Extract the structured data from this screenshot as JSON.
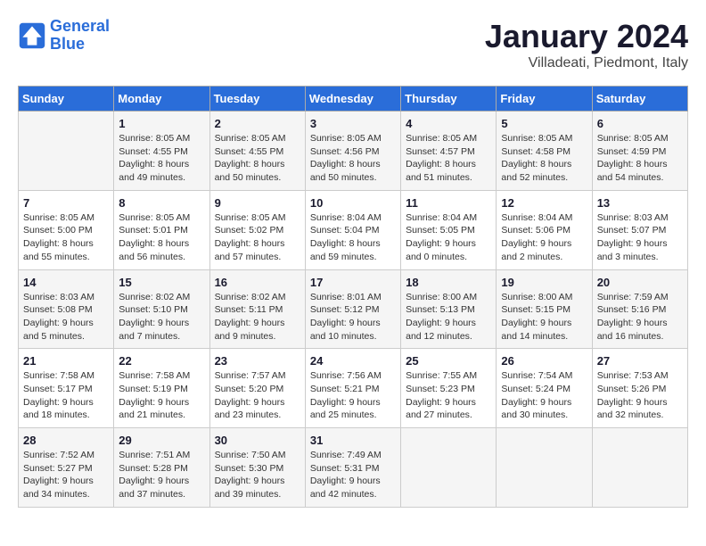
{
  "header": {
    "logo_line1": "General",
    "logo_line2": "Blue",
    "title": "January 2024",
    "subtitle": "Villadeati, Piedmont, Italy"
  },
  "weekdays": [
    "Sunday",
    "Monday",
    "Tuesday",
    "Wednesday",
    "Thursday",
    "Friday",
    "Saturday"
  ],
  "weeks": [
    [
      {
        "day": "",
        "info": ""
      },
      {
        "day": "1",
        "info": "Sunrise: 8:05 AM\nSunset: 4:55 PM\nDaylight: 8 hours\nand 49 minutes."
      },
      {
        "day": "2",
        "info": "Sunrise: 8:05 AM\nSunset: 4:55 PM\nDaylight: 8 hours\nand 50 minutes."
      },
      {
        "day": "3",
        "info": "Sunrise: 8:05 AM\nSunset: 4:56 PM\nDaylight: 8 hours\nand 50 minutes."
      },
      {
        "day": "4",
        "info": "Sunrise: 8:05 AM\nSunset: 4:57 PM\nDaylight: 8 hours\nand 51 minutes."
      },
      {
        "day": "5",
        "info": "Sunrise: 8:05 AM\nSunset: 4:58 PM\nDaylight: 8 hours\nand 52 minutes."
      },
      {
        "day": "6",
        "info": "Sunrise: 8:05 AM\nSunset: 4:59 PM\nDaylight: 8 hours\nand 54 minutes."
      }
    ],
    [
      {
        "day": "7",
        "info": "Sunrise: 8:05 AM\nSunset: 5:00 PM\nDaylight: 8 hours\nand 55 minutes."
      },
      {
        "day": "8",
        "info": "Sunrise: 8:05 AM\nSunset: 5:01 PM\nDaylight: 8 hours\nand 56 minutes."
      },
      {
        "day": "9",
        "info": "Sunrise: 8:05 AM\nSunset: 5:02 PM\nDaylight: 8 hours\nand 57 minutes."
      },
      {
        "day": "10",
        "info": "Sunrise: 8:04 AM\nSunset: 5:04 PM\nDaylight: 8 hours\nand 59 minutes."
      },
      {
        "day": "11",
        "info": "Sunrise: 8:04 AM\nSunset: 5:05 PM\nDaylight: 9 hours\nand 0 minutes."
      },
      {
        "day": "12",
        "info": "Sunrise: 8:04 AM\nSunset: 5:06 PM\nDaylight: 9 hours\nand 2 minutes."
      },
      {
        "day": "13",
        "info": "Sunrise: 8:03 AM\nSunset: 5:07 PM\nDaylight: 9 hours\nand 3 minutes."
      }
    ],
    [
      {
        "day": "14",
        "info": "Sunrise: 8:03 AM\nSunset: 5:08 PM\nDaylight: 9 hours\nand 5 minutes."
      },
      {
        "day": "15",
        "info": "Sunrise: 8:02 AM\nSunset: 5:10 PM\nDaylight: 9 hours\nand 7 minutes."
      },
      {
        "day": "16",
        "info": "Sunrise: 8:02 AM\nSunset: 5:11 PM\nDaylight: 9 hours\nand 9 minutes."
      },
      {
        "day": "17",
        "info": "Sunrise: 8:01 AM\nSunset: 5:12 PM\nDaylight: 9 hours\nand 10 minutes."
      },
      {
        "day": "18",
        "info": "Sunrise: 8:00 AM\nSunset: 5:13 PM\nDaylight: 9 hours\nand 12 minutes."
      },
      {
        "day": "19",
        "info": "Sunrise: 8:00 AM\nSunset: 5:15 PM\nDaylight: 9 hours\nand 14 minutes."
      },
      {
        "day": "20",
        "info": "Sunrise: 7:59 AM\nSunset: 5:16 PM\nDaylight: 9 hours\nand 16 minutes."
      }
    ],
    [
      {
        "day": "21",
        "info": "Sunrise: 7:58 AM\nSunset: 5:17 PM\nDaylight: 9 hours\nand 18 minutes."
      },
      {
        "day": "22",
        "info": "Sunrise: 7:58 AM\nSunset: 5:19 PM\nDaylight: 9 hours\nand 21 minutes."
      },
      {
        "day": "23",
        "info": "Sunrise: 7:57 AM\nSunset: 5:20 PM\nDaylight: 9 hours\nand 23 minutes."
      },
      {
        "day": "24",
        "info": "Sunrise: 7:56 AM\nSunset: 5:21 PM\nDaylight: 9 hours\nand 25 minutes."
      },
      {
        "day": "25",
        "info": "Sunrise: 7:55 AM\nSunset: 5:23 PM\nDaylight: 9 hours\nand 27 minutes."
      },
      {
        "day": "26",
        "info": "Sunrise: 7:54 AM\nSunset: 5:24 PM\nDaylight: 9 hours\nand 30 minutes."
      },
      {
        "day": "27",
        "info": "Sunrise: 7:53 AM\nSunset: 5:26 PM\nDaylight: 9 hours\nand 32 minutes."
      }
    ],
    [
      {
        "day": "28",
        "info": "Sunrise: 7:52 AM\nSunset: 5:27 PM\nDaylight: 9 hours\nand 34 minutes."
      },
      {
        "day": "29",
        "info": "Sunrise: 7:51 AM\nSunset: 5:28 PM\nDaylight: 9 hours\nand 37 minutes."
      },
      {
        "day": "30",
        "info": "Sunrise: 7:50 AM\nSunset: 5:30 PM\nDaylight: 9 hours\nand 39 minutes."
      },
      {
        "day": "31",
        "info": "Sunrise: 7:49 AM\nSunset: 5:31 PM\nDaylight: 9 hours\nand 42 minutes."
      },
      {
        "day": "",
        "info": ""
      },
      {
        "day": "",
        "info": ""
      },
      {
        "day": "",
        "info": ""
      }
    ]
  ]
}
